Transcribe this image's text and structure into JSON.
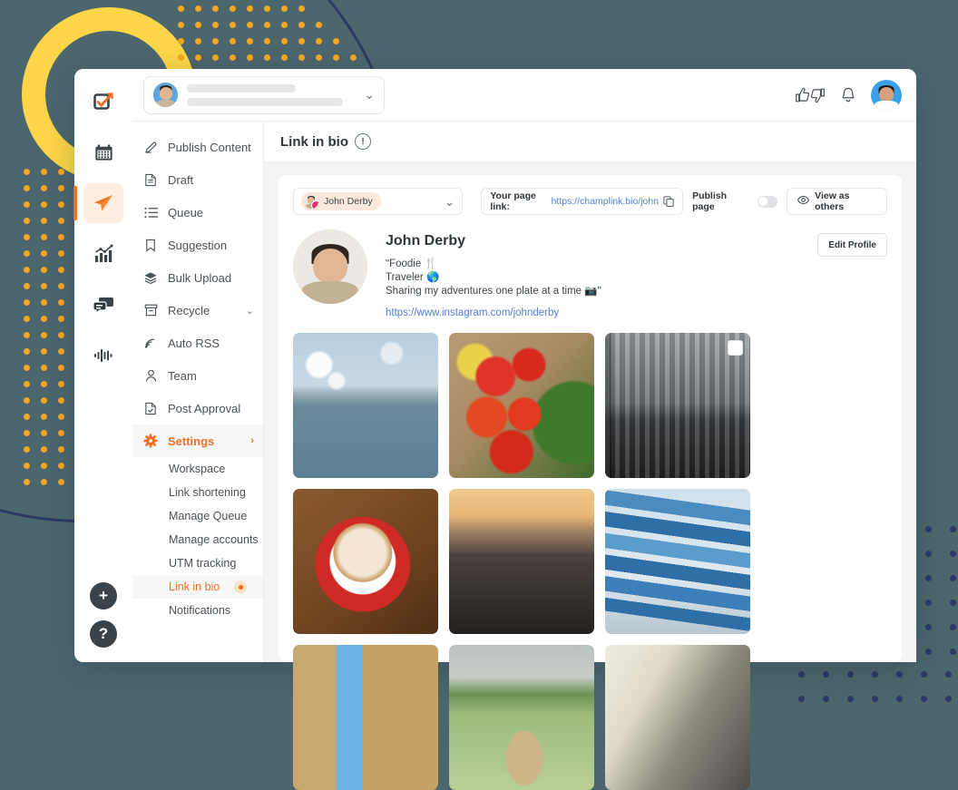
{
  "window": {
    "rail": {
      "items": [
        {
          "name": "compose",
          "icon": "checkbox-pencil-icon",
          "active": false
        },
        {
          "name": "calendar",
          "icon": "calendar-icon",
          "active": false
        },
        {
          "name": "publish",
          "icon": "paper-plane-icon",
          "active": true
        },
        {
          "name": "analytics",
          "icon": "bar-chart-icon",
          "active": false
        },
        {
          "name": "inbox",
          "icon": "chat-bubbles-icon",
          "active": false
        },
        {
          "name": "activity",
          "icon": "waveform-icon",
          "active": false
        }
      ],
      "add_label": "+",
      "help_label": "?"
    },
    "topbar": {
      "account_selector_placeholder": "",
      "chevron": "⌄",
      "icons": [
        "thumbs-up-icon",
        "thumbs-down-icon",
        "bell-icon",
        "user-avatar"
      ]
    }
  },
  "sidebar": {
    "items": [
      {
        "label": "Publish Content",
        "icon": "pencil-icon",
        "selected": false,
        "caret": ""
      },
      {
        "label": "Draft",
        "icon": "document-icon",
        "selected": false,
        "caret": ""
      },
      {
        "label": "Queue",
        "icon": "list-icon",
        "selected": false,
        "caret": ""
      },
      {
        "label": "Suggestion",
        "icon": "bookmark-icon",
        "selected": false,
        "caret": ""
      },
      {
        "label": "Bulk Upload",
        "icon": "layers-icon",
        "selected": false,
        "caret": ""
      },
      {
        "label": "Recycle",
        "icon": "archive-icon",
        "selected": false,
        "caret": "⌄"
      },
      {
        "label": "Auto RSS",
        "icon": "rss-icon",
        "selected": false,
        "caret": ""
      },
      {
        "label": "Team",
        "icon": "person-icon",
        "selected": false,
        "caret": ""
      },
      {
        "label": "Post Approval",
        "icon": "document-check-icon",
        "selected": false,
        "caret": ""
      },
      {
        "label": "Settings",
        "icon": "gear-icon",
        "selected": true,
        "caret": "›"
      }
    ],
    "sub_items": [
      {
        "label": "Workspace",
        "selected": false,
        "badge": false
      },
      {
        "label": "Link shortening",
        "selected": false,
        "badge": false
      },
      {
        "label": "Manage Queue",
        "selected": false,
        "badge": false
      },
      {
        "label": "Manage accounts",
        "selected": false,
        "badge": false
      },
      {
        "label": "UTM tracking",
        "selected": false,
        "badge": false
      },
      {
        "label": "Link in bio",
        "selected": true,
        "badge": true
      },
      {
        "label": "Notifications",
        "selected": false,
        "badge": false
      }
    ]
  },
  "page": {
    "title": "Link in bio",
    "info_icon": "!",
    "toolbar": {
      "account_name": "John Derby",
      "account_chevron": "⌄",
      "page_link_label": "Your page link:",
      "page_link_url": "https://champlink.bio/john",
      "copy_icon": "copy-icon",
      "publish_label": "Publish page",
      "publish_on": false,
      "view_as_label": "View as others",
      "eye_icon": "eye-icon"
    },
    "profile": {
      "name": "John Derby",
      "bio_line1": "ʺFoodie 🍴",
      "bio_line2": "Traveler 🌎",
      "bio_line3": "Sharing my adventures one plate at a time 📷ʺ",
      "link": "https://www.instagram.com/johnderby",
      "edit_label": "Edit Profile"
    },
    "grid": [
      {
        "alt": "seagulls-over-sea",
        "art": "ph-sea",
        "selected": false
      },
      {
        "alt": "tomatoes-in-basket",
        "art": "ph-tom",
        "selected": false
      },
      {
        "alt": "brooklyn-bridge-skyline-bw",
        "art": "ph-bw",
        "selected": true
      },
      {
        "alt": "latte-art-coffee-cup",
        "art": "ph-cof",
        "selected": false
      },
      {
        "alt": "city-sunset-skyline",
        "art": "ph-city",
        "selected": false
      },
      {
        "alt": "destination-signpost",
        "art": "ph-sign",
        "selected": false
      },
      {
        "alt": "narrow-european-street",
        "art": "ph-street",
        "selected": false
      },
      {
        "alt": "cow-in-green-field",
        "art": "ph-cow",
        "selected": false
      },
      {
        "alt": "camera-over-rocks",
        "art": "ph-rock",
        "selected": false
      }
    ]
  },
  "theme": {
    "background": "#4c666e",
    "accent": "#f26f21",
    "yellow": "#fcd548",
    "navy": "#2d3a66",
    "link": "#4f7fd4"
  }
}
